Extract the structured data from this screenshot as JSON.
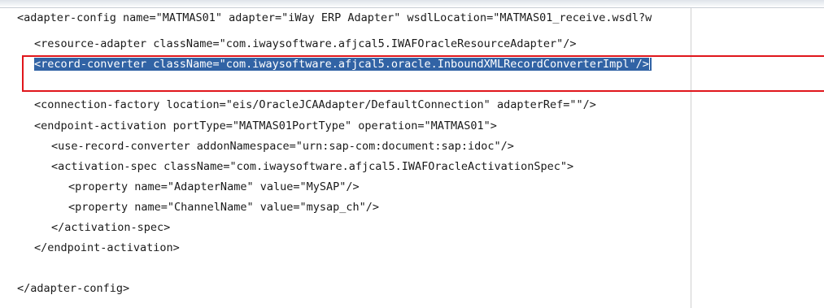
{
  "code_lines": [
    "<adapter-config name=\"MATMAS01\" adapter=\"iWay ERP Adapter\" wsdlLocation=\"MATMAS01_receive.wsdl?w",
    "<resource-adapter className=\"com.iwaysoftware.afjcal5.IWAFOracleResourceAdapter\"/>",
    "<record-converter className=\"com.iwaysoftware.afjcal5.oracle.InboundXMLRecordConverterImpl\"/>",
    "<connection-factory location=\"eis/OracleJCAAdapter/DefaultConnection\" adapterRef=\"\"/>",
    "<endpoint-activation portType=\"MATMAS01PortType\" operation=\"MATMAS01\">",
    "<use-record-converter addonNamespace=\"urn:sap-com:document:sap:idoc\"/>",
    "<activation-spec className=\"com.iwaysoftware.afjcal5.IWAFOracleActivationSpec\">",
    "<property name=\"AdapterName\" value=\"MySAP\"/>",
    "<property name=\"ChannelName\" value=\"mysap_ch\"/>",
    "</activation-spec>",
    "</endpoint-activation>",
    "</adapter-config>"
  ],
  "colors": {
    "selection_bg": "#3163a5",
    "selection_fg": "#ffffff",
    "highlight_border": "#e0161c",
    "text": "#1a1a1a"
  }
}
